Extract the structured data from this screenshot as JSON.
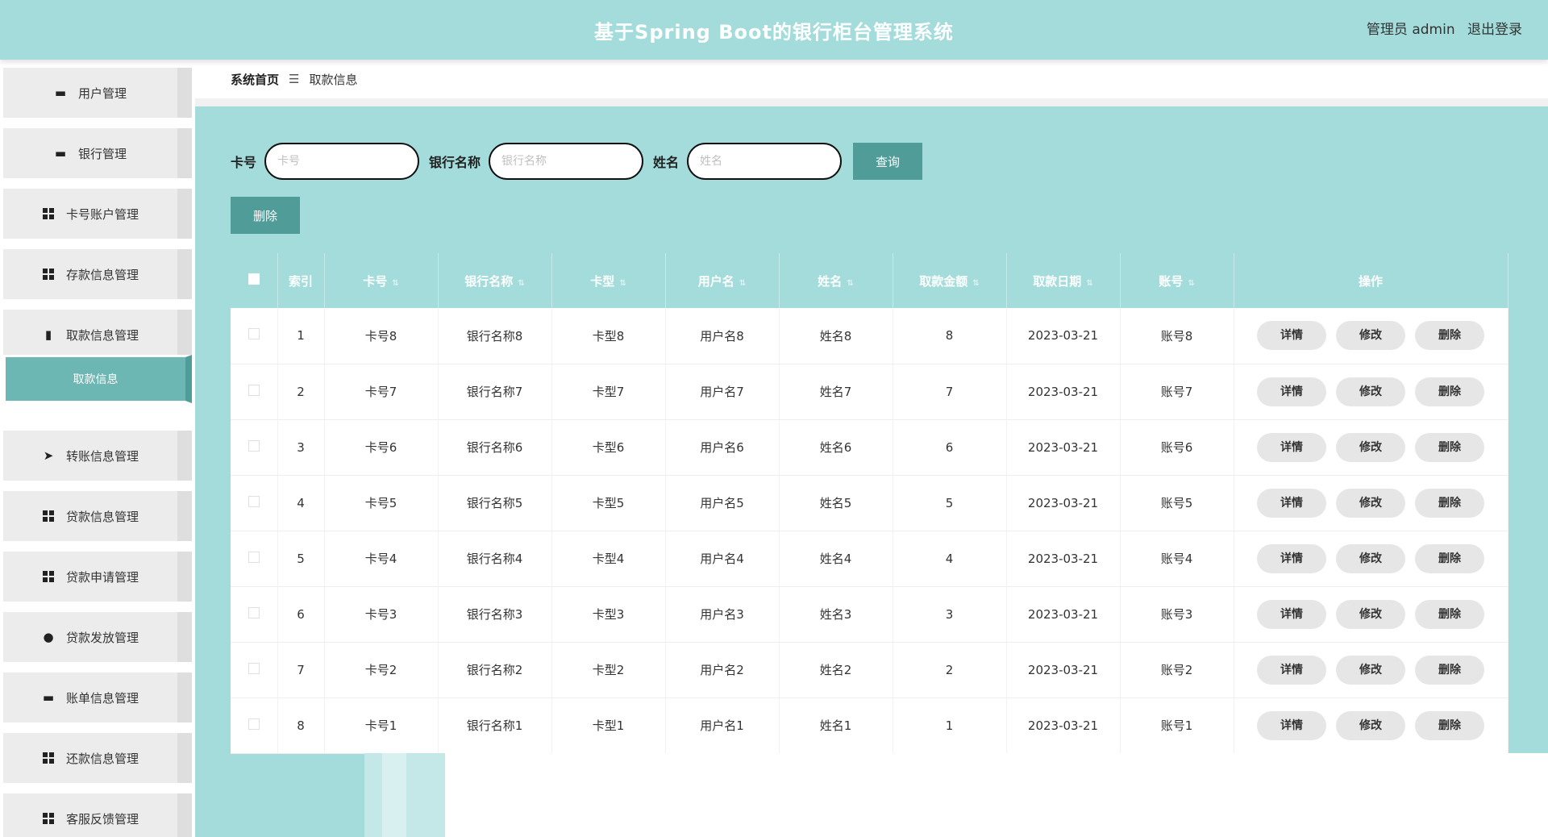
{
  "header": {
    "title": "基于Spring Boot的银行柜台管理系统",
    "user": "管理员 admin",
    "logout": "退出登录"
  },
  "sidebar": {
    "items": [
      {
        "label": "用户管理",
        "icon": "id-card-icon"
      },
      {
        "label": "银行管理",
        "icon": "briefcase-icon"
      },
      {
        "label": "卡号账户管理",
        "icon": "grid-icon"
      },
      {
        "label": "存款信息管理",
        "icon": "grid-icon"
      },
      {
        "label": "取款信息管理",
        "icon": "clipboard-icon"
      },
      {
        "label": "转账信息管理",
        "icon": "send-icon"
      },
      {
        "label": "贷款信息管理",
        "icon": "grid-icon"
      },
      {
        "label": "贷款申请管理",
        "icon": "grid-icon"
      },
      {
        "label": "贷款发放管理",
        "icon": "user-icon"
      },
      {
        "label": "账单信息管理",
        "icon": "card-icon"
      },
      {
        "label": "还款信息管理",
        "icon": "grid-icon"
      },
      {
        "label": "客服反馈管理",
        "icon": "grid-icon"
      }
    ],
    "active_sub": "取款信息"
  },
  "breadcrumb": {
    "home": "系统首页",
    "sep": "☰",
    "current": "取款信息"
  },
  "search": {
    "card_label": "卡号",
    "card_placeholder": "卡号",
    "bank_label": "银行名称",
    "bank_placeholder": "银行名称",
    "name_label": "姓名",
    "name_placeholder": "姓名",
    "query": "查询"
  },
  "actions": {
    "delete": "删除"
  },
  "table": {
    "columns": [
      "索引",
      "卡号",
      "银行名称",
      "卡型",
      "用户名",
      "姓名",
      "取款金额",
      "取款日期",
      "账号",
      "操作"
    ],
    "rows": [
      [
        "1",
        "卡号8",
        "银行名称8",
        "卡型8",
        "用户名8",
        "姓名8",
        "8",
        "2023-03-21",
        "账号8"
      ],
      [
        "2",
        "卡号7",
        "银行名称7",
        "卡型7",
        "用户名7",
        "姓名7",
        "7",
        "2023-03-21",
        "账号7"
      ],
      [
        "3",
        "卡号6",
        "银行名称6",
        "卡型6",
        "用户名6",
        "姓名6",
        "6",
        "2023-03-21",
        "账号6"
      ],
      [
        "4",
        "卡号5",
        "银行名称5",
        "卡型5",
        "用户名5",
        "姓名5",
        "5",
        "2023-03-21",
        "账号5"
      ],
      [
        "5",
        "卡号4",
        "银行名称4",
        "卡型4",
        "用户名4",
        "姓名4",
        "4",
        "2023-03-21",
        "账号4"
      ],
      [
        "6",
        "卡号3",
        "银行名称3",
        "卡型3",
        "用户名3",
        "姓名3",
        "3",
        "2023-03-21",
        "账号3"
      ],
      [
        "7",
        "卡号2",
        "银行名称2",
        "卡型2",
        "用户名2",
        "姓名2",
        "2",
        "2023-03-21",
        "账号2"
      ],
      [
        "8",
        "卡号1",
        "银行名称1",
        "卡型1",
        "用户名1",
        "姓名1",
        "1",
        "2023-03-21",
        "账号1"
      ]
    ],
    "row_actions": {
      "detail": "详情",
      "edit": "修改",
      "delete": "删除"
    }
  },
  "colors": {
    "accent": "#a4dcdc",
    "button": "#4f9c99",
    "active_sub": "#6cb6b3"
  }
}
